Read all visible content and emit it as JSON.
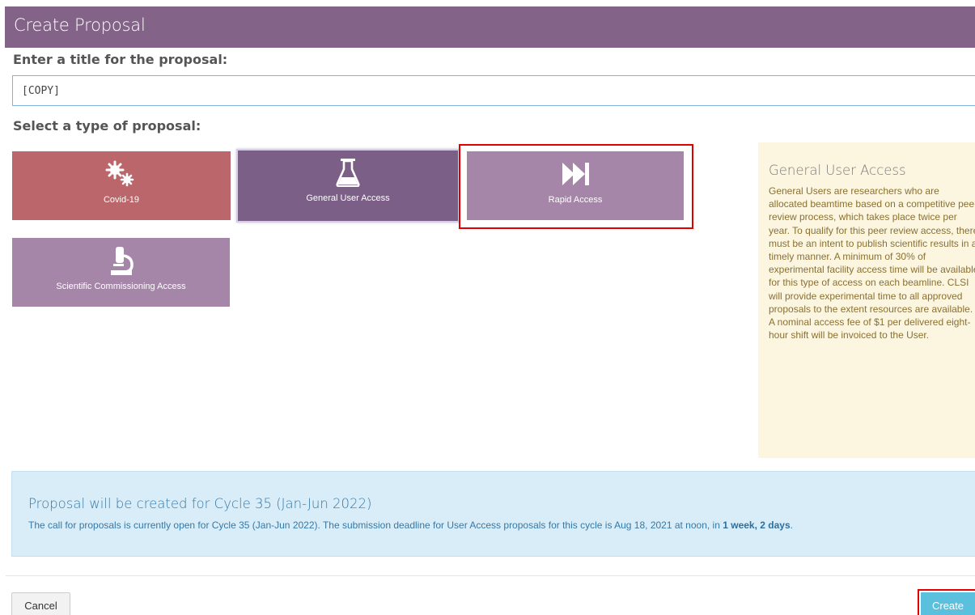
{
  "header": {
    "title": "Create Proposal"
  },
  "form": {
    "title_label": "Enter a title for the proposal:",
    "title_value": "[COPY]",
    "type_label": "Select a type of proposal:"
  },
  "tiles": [
    {
      "label": "Covid-19",
      "icon": "gears-icon",
      "color": "#bb666a"
    },
    {
      "label": "General User Access",
      "icon": "flask-icon",
      "color": "#7b5f87",
      "selected": true
    },
    {
      "label": "Rapid Access",
      "icon": "fast-forward-icon",
      "color": "#a586a9"
    },
    {
      "label": "Scientific Commissioning Access",
      "icon": "microscope-icon",
      "color": "#a586a9"
    }
  ],
  "info": {
    "title": "General User Access",
    "body": "General Users are researchers who are allocated beamtime based on a competitive peer review process, which takes place twice per year. To qualify for this peer review access, there must be an intent to publish scientific results in a timely manner. A minimum of 30% of experimental facility access time will be available for this type of access on each beamline. CLSI will provide experimental time to all approved proposals to the extent resources are available. A nominal access fee of $1 per delivered eight-hour shift will be invoiced to the User."
  },
  "cycle": {
    "title": "Proposal will be created for Cycle 35 (Jan-Jun 2022)",
    "text_prefix": "The call for proposals is currently open for Cycle 35 (Jan-Jun 2022). The submission deadline for User Access proposals for this cycle is Aug 18, 2021 at noon, in ",
    "deadline_remaining": "1 week, 2 days",
    "text_suffix": "."
  },
  "footer": {
    "cancel_label": "Cancel",
    "create_label": "Create"
  },
  "colors": {
    "header_bg": "#836387",
    "covid_tile": "#bb666a",
    "selected_tile": "#7b5f87",
    "tile": "#a586a9",
    "info_bg": "#fcf6e1",
    "cycle_bg": "#d9edf8",
    "create_button": "#5bc0de"
  }
}
